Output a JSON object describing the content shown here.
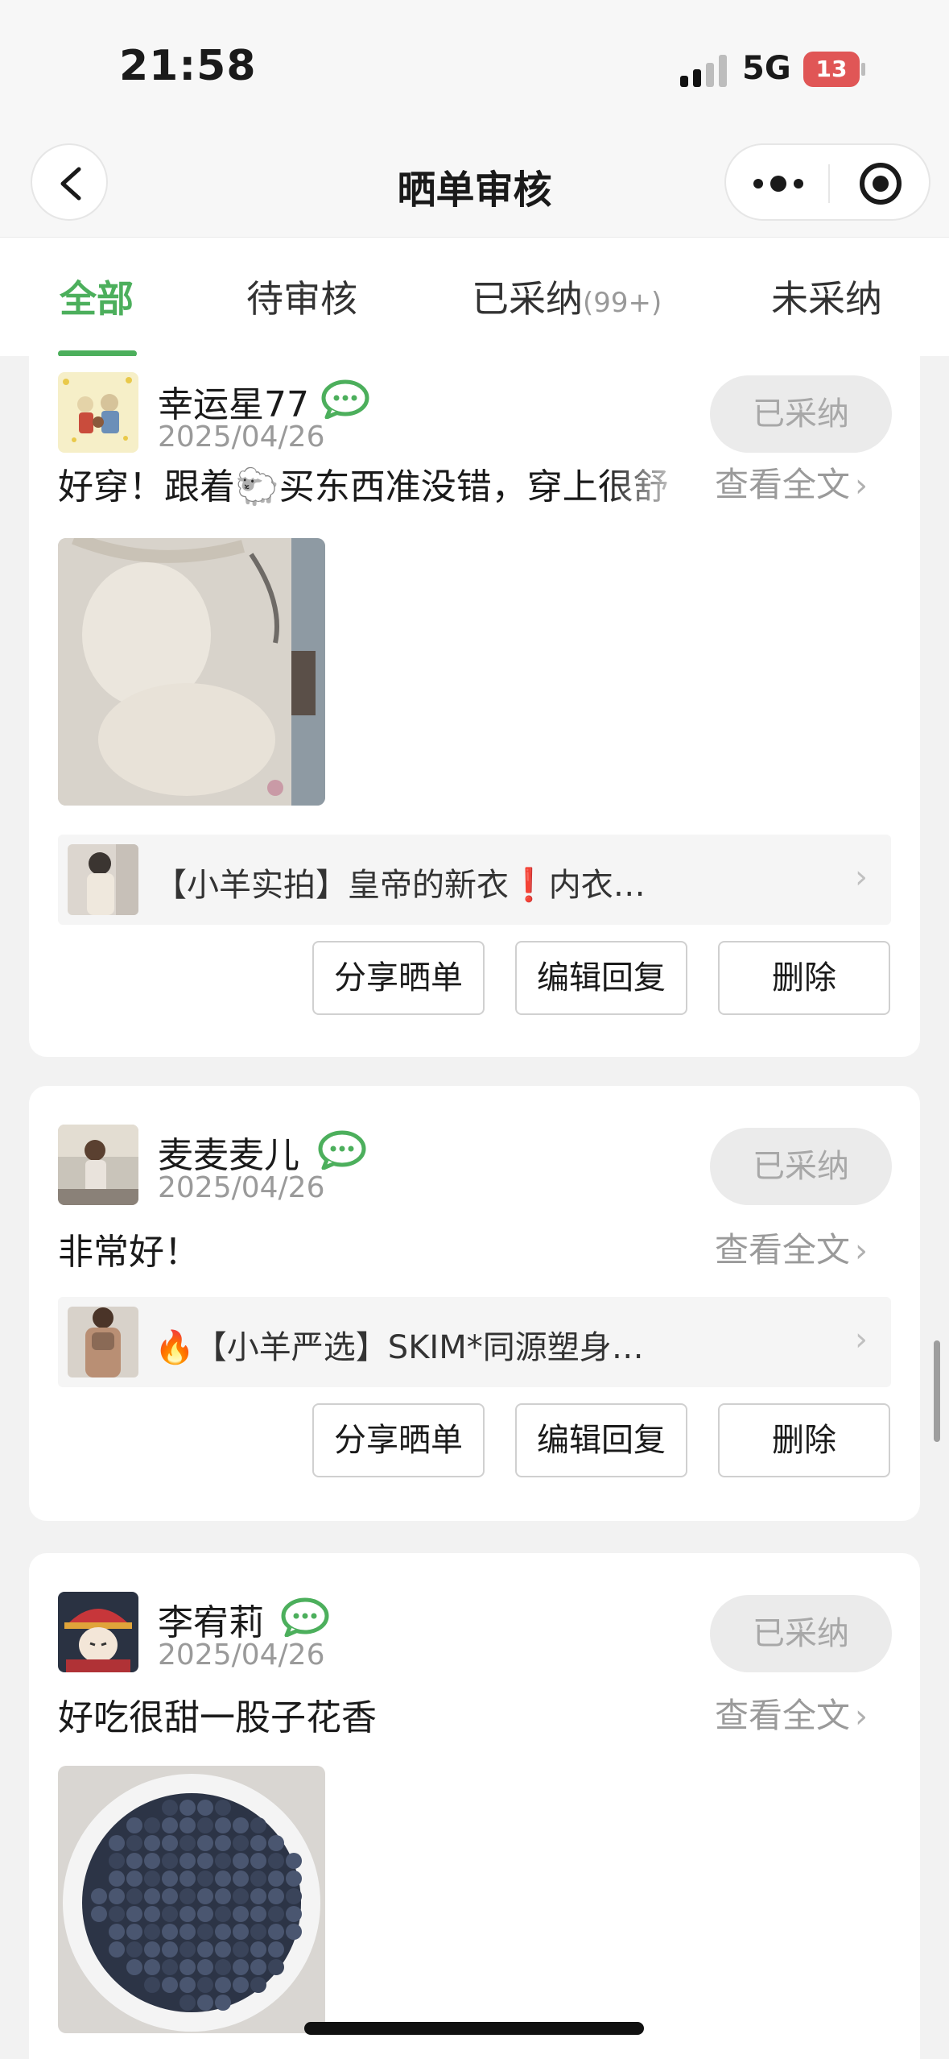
{
  "status_bar": {
    "time": "21:58",
    "network": "5G",
    "battery": "13"
  },
  "nav": {
    "title": "晒单审核"
  },
  "tabs": [
    {
      "label": "全部",
      "active": true
    },
    {
      "label": "待审核"
    },
    {
      "label": "已采纳",
      "count": "(99+)"
    },
    {
      "label": "未采纳"
    }
  ],
  "reviews": [
    {
      "username": "幸运星77",
      "date": "2025/04/26",
      "status": "已采纳",
      "comment": "好穿！跟着🐑买东西准没错，穿上很舒",
      "view_full": "查看全文",
      "has_photo": true,
      "product": "【小羊实拍】皇帝的新衣❗️内衣…",
      "actions": [
        "分享晒单",
        "编辑回复",
        "删除"
      ]
    },
    {
      "username": "麦麦麦儿",
      "date": "2025/04/26",
      "status": "已采纳",
      "comment": "非常好！",
      "view_full": "查看全文",
      "has_photo": false,
      "product": "🔥【小羊严选】SKIM*同源塑身…",
      "actions": [
        "分享晒单",
        "编辑回复",
        "删除"
      ]
    },
    {
      "username": "李宥莉",
      "date": "2025/04/26",
      "status": "已采纳",
      "comment": "好吃很甜一股子花香",
      "view_full": "查看全文",
      "has_photo": true
    }
  ],
  "colors": {
    "accent": "#4caf5c",
    "badge_bg": "#ebebeb",
    "badge_text": "#a8a8a8"
  }
}
